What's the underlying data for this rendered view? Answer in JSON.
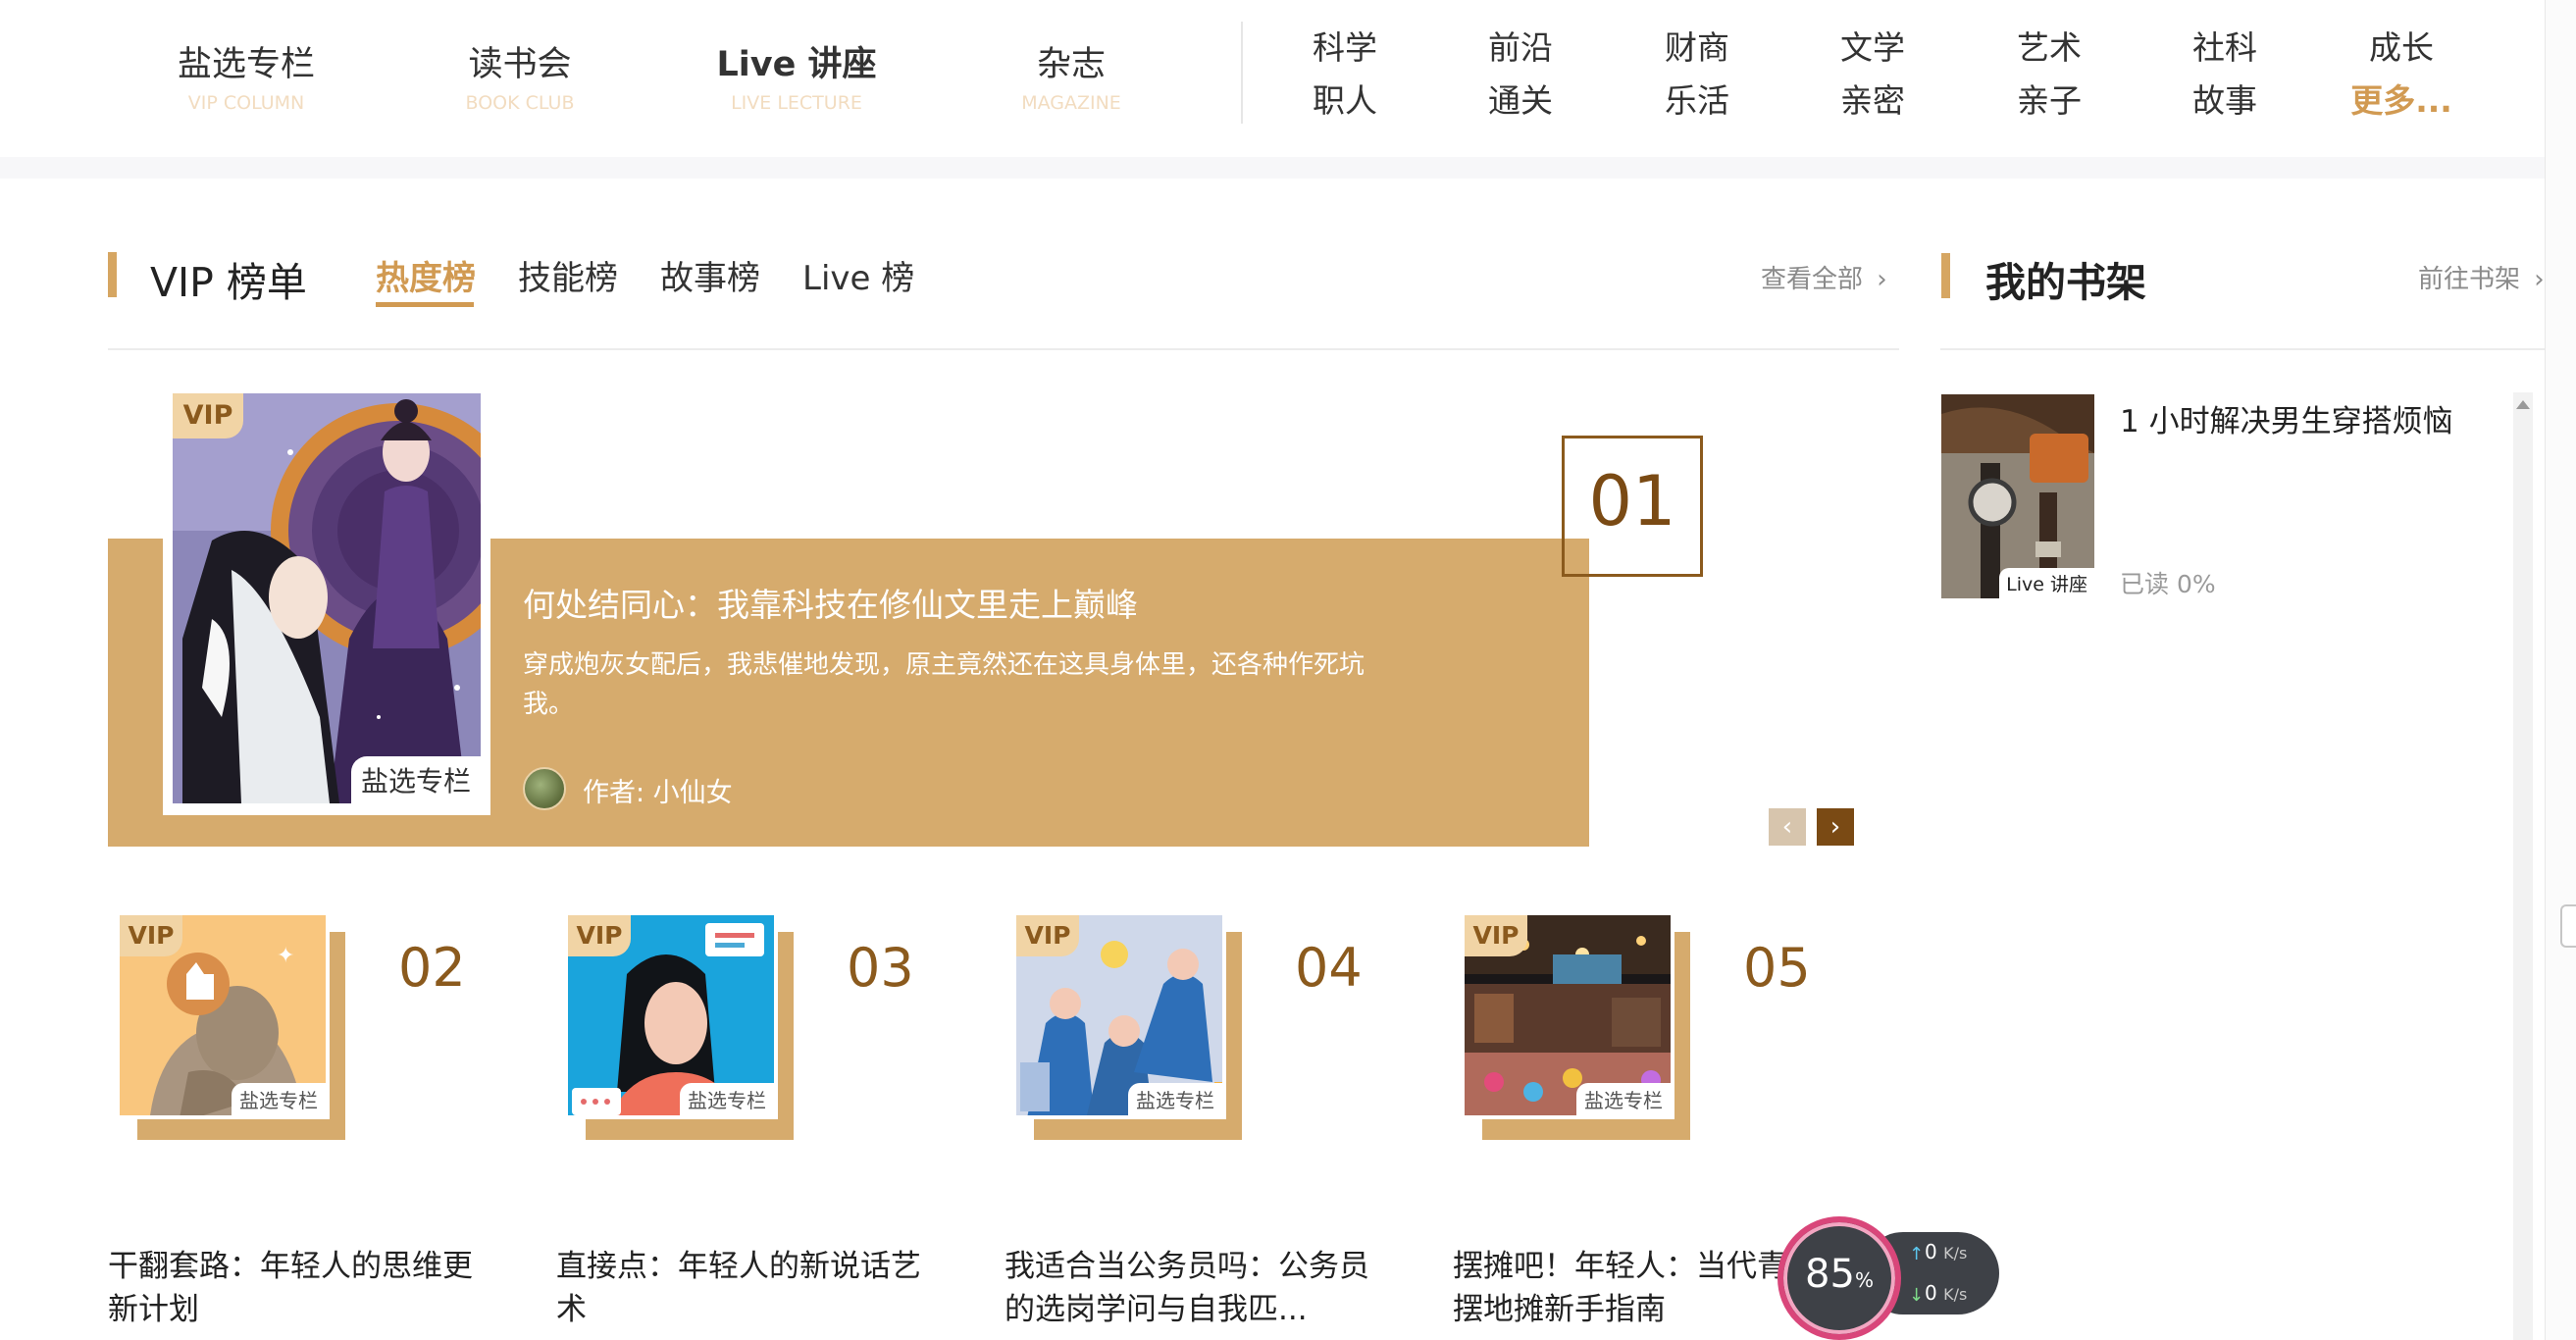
{
  "main_nav": [
    {
      "label": "盐选专栏",
      "sub": "VIP COLUMN"
    },
    {
      "label": "读书会",
      "sub": "BOOK CLUB"
    },
    {
      "label": "Live 讲座",
      "sub": "LIVE LECTURE"
    },
    {
      "label": "杂志",
      "sub": "MAGAZINE"
    }
  ],
  "categories": [
    {
      "top": "科学",
      "bottom": "职人"
    },
    {
      "top": "前沿",
      "bottom": "通关"
    },
    {
      "top": "财商",
      "bottom": "乐活"
    },
    {
      "top": "文学",
      "bottom": "亲密"
    },
    {
      "top": "艺术",
      "bottom": "亲子"
    },
    {
      "top": "社科",
      "bottom": "故事"
    },
    {
      "top": "成长",
      "bottom": "更多..."
    }
  ],
  "ranking": {
    "title": "VIP 榜单",
    "tabs": [
      "热度榜",
      "技能榜",
      "故事榜",
      "Live 榜"
    ],
    "active_tab": "热度榜",
    "view_all": "查看全部",
    "featured": {
      "rank": "01",
      "vip": "VIP",
      "column_label": "盐选专栏",
      "title": "何处结同心：我靠科技在修仙文里走上巅峰",
      "description": "穿成炮灰女配后，我悲催地发现，原主竟然还在这具身体里，还各种作死坑我。",
      "author": "作者: 小仙女"
    },
    "items": [
      {
        "rank": "02",
        "vip": "VIP",
        "column_label": "盐选专栏",
        "title": "干翻套路：年轻人的思维更新计划"
      },
      {
        "rank": "03",
        "vip": "VIP",
        "column_label": "盐选专栏",
        "title": "直接点：年轻人的新说话艺术"
      },
      {
        "rank": "04",
        "vip": "VIP",
        "column_label": "盐选专栏",
        "title": "我适合当公务员吗：公务员的选岗学问与自我匹..."
      },
      {
        "rank": "05",
        "vip": "VIP",
        "column_label": "盐选专栏",
        "title": "摆摊吧！年轻人：当代青年摆地摊新手指南"
      }
    ]
  },
  "bookshelf": {
    "title": "我的书架",
    "goto": "前往书架",
    "items": [
      {
        "title": "1 小时解决男生穿搭烦恼",
        "label": "Live 讲座",
        "progress": "已读 0%"
      }
    ]
  },
  "speed_widget": {
    "percent": "85",
    "percent_sign": "%",
    "upload": "0",
    "download": "0",
    "unit": "K/s"
  },
  "colors": {
    "accent": "#d19a52",
    "gold_bg": "#d6ab6d",
    "dark_brown": "#7a4a14"
  }
}
